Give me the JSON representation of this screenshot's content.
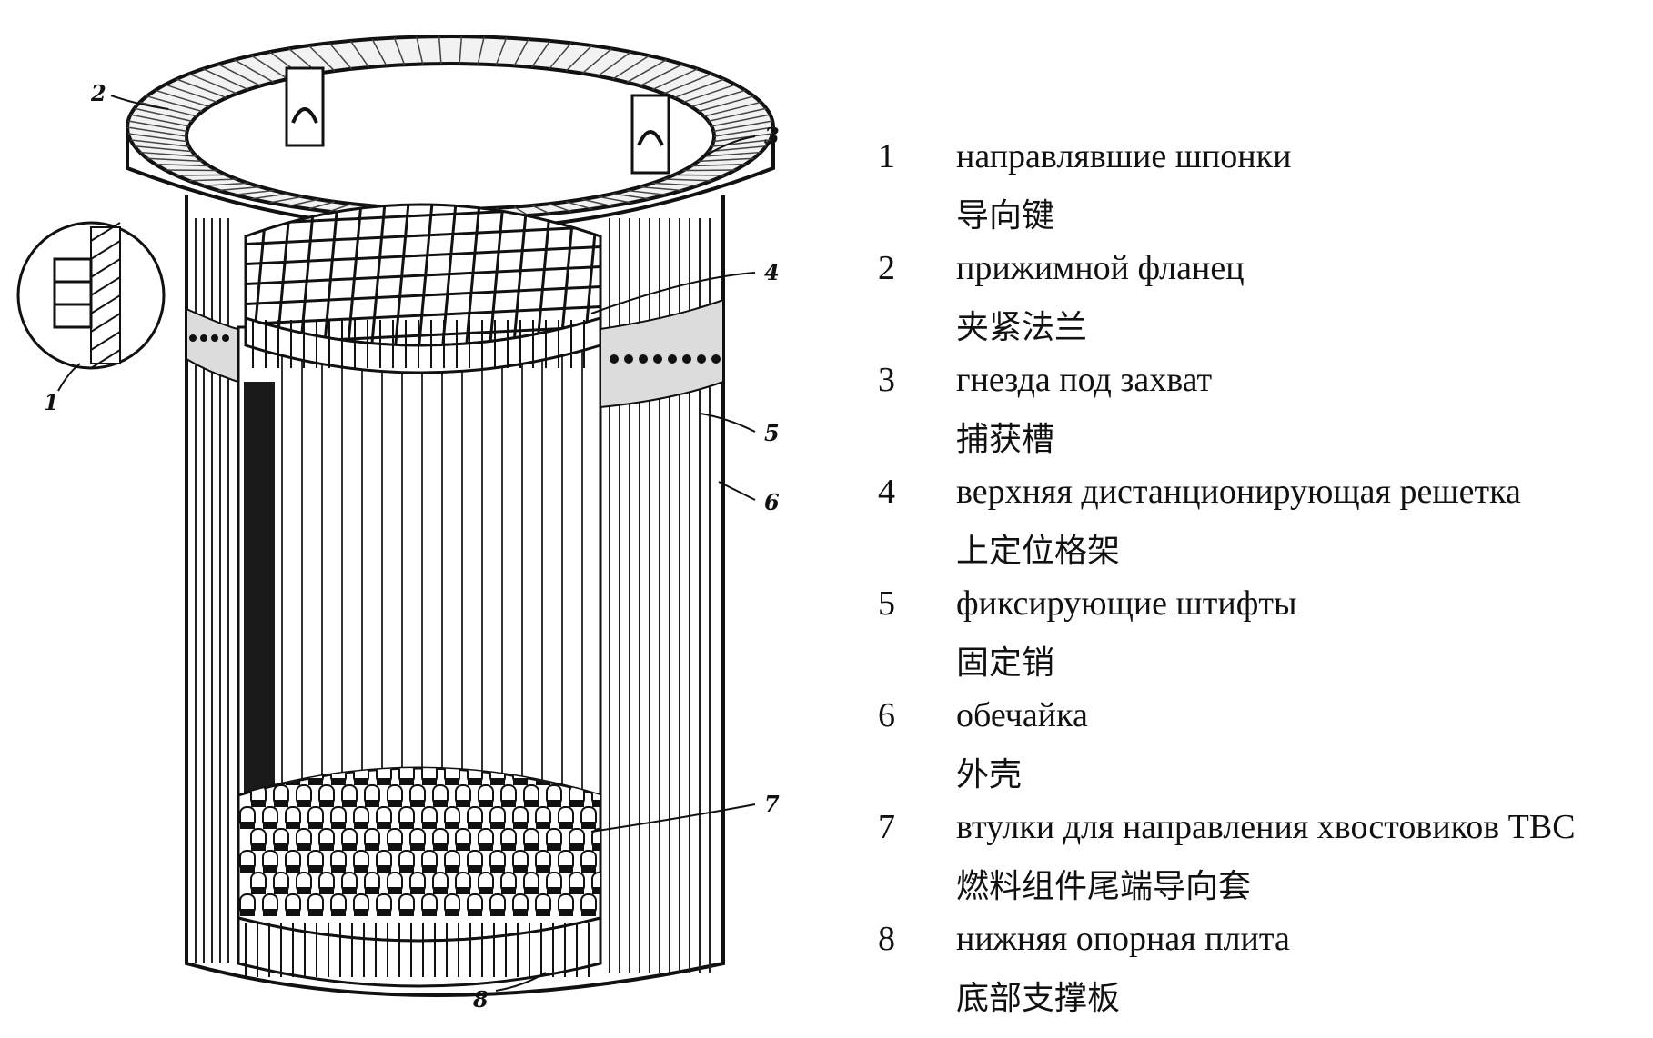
{
  "callouts": [
    "1",
    "2",
    "3",
    "4",
    "5",
    "6",
    "7",
    "8"
  ],
  "legend": [
    {
      "num": "1",
      "ru": "направлявшие шпонки",
      "zh": "导向键"
    },
    {
      "num": "2",
      "ru": "прижимной фланец",
      "zh": "夹紧法兰"
    },
    {
      "num": "3",
      "ru": "гнезда под захват",
      "zh": "捕获槽"
    },
    {
      "num": "4",
      "ru": "верхняя дистанционирующая решетка",
      "zh": "上定位格架"
    },
    {
      "num": "5",
      "ru": "фиксирующие штифты",
      "zh": "固定销"
    },
    {
      "num": "6",
      "ru": "обечайка",
      "zh": "外壳"
    },
    {
      "num": "7",
      "ru": "втулки для направления хвостовиков ТВС",
      "zh": "燃料组件尾端导向套"
    },
    {
      "num": "8",
      "ru": "нижняя опорная плита",
      "zh": "底部支撑板"
    }
  ]
}
